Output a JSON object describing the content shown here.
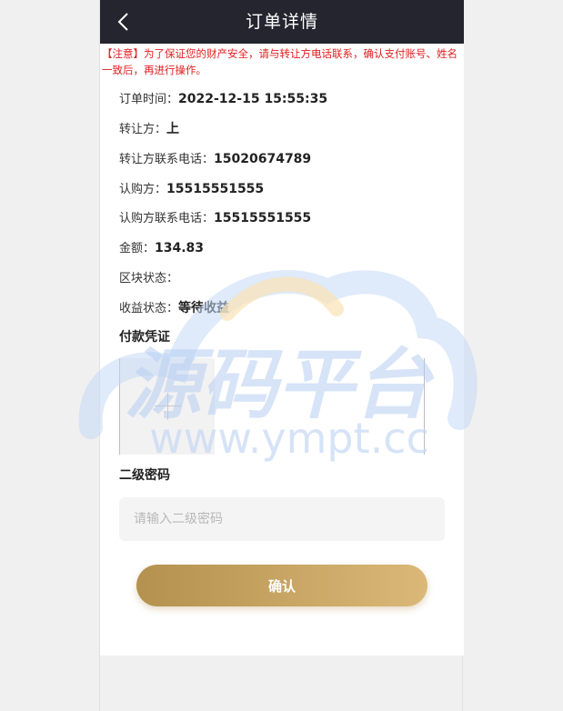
{
  "header": {
    "title": "订单详情",
    "back_icon": "chevron-left-icon"
  },
  "notice": "【注意】为了保证您的财产安全，请与转让方电话联系，确认支付账号、姓名一致后，再进行操作。",
  "details": [
    {
      "label": "订单时间：",
      "value": "2022-12-15 15:55:35"
    },
    {
      "label": "转让方：",
      "value": "上"
    },
    {
      "label": "转让方联系电话：",
      "value": "15020674789"
    },
    {
      "label": "认购方：",
      "value": "15515551555"
    },
    {
      "label": "认购方联系电话：",
      "value": "15515551555"
    },
    {
      "label": "金额：",
      "value": "134.83"
    },
    {
      "label": "区块状态：",
      "value": ""
    },
    {
      "label": "收益状态：",
      "value": "等待收益"
    }
  ],
  "voucher": {
    "title": "付款凭证"
  },
  "password": {
    "title": "二级密码",
    "placeholder": "请输入二级密码",
    "value": ""
  },
  "confirm_label": "确认",
  "watermark": {
    "main": "源码平台",
    "sub": "www.ympt.cc"
  },
  "colors": {
    "header_bg": "#252530",
    "notice_text": "#e02020",
    "button_start": "#b4914f",
    "button_end": "#dbb877"
  }
}
